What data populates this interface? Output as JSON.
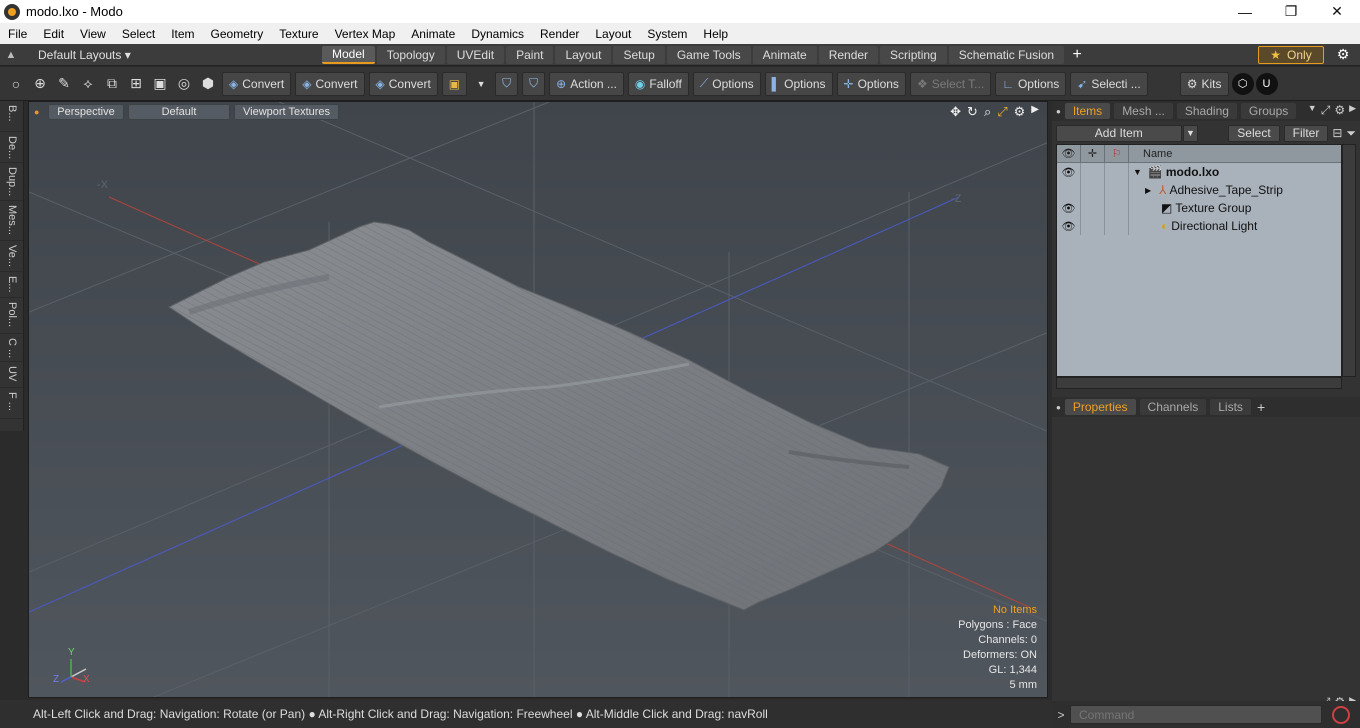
{
  "window": {
    "title": "modo.lxo - Modo",
    "minimize": "—",
    "maximize": "❐",
    "close": "✕"
  },
  "menu": [
    "File",
    "Edit",
    "View",
    "Select",
    "Item",
    "Geometry",
    "Texture",
    "Vertex Map",
    "Animate",
    "Dynamics",
    "Render",
    "Layout",
    "System",
    "Help"
  ],
  "layout": {
    "default_layouts": "Default Layouts ▾",
    "tabs": [
      "Model",
      "Topology",
      "UVEdit",
      "Paint",
      "Layout",
      "Setup",
      "Game Tools",
      "Animate",
      "Render",
      "Scripting",
      "Schematic Fusion"
    ],
    "active_tab": "Model",
    "only_label": "Only"
  },
  "toolbar": {
    "convert1": "Convert",
    "convert2": "Convert",
    "convert3": "Convert",
    "action": "Action ...",
    "falloff": "Falloff",
    "options1": "Options",
    "options2": "Options",
    "options3": "Options",
    "select_t": "Select T...",
    "options4": "Options",
    "selecti": "Selecti ...",
    "kits": "Kits"
  },
  "left_tabs": [
    "B...",
    "De...",
    "Dup...",
    "Mes...",
    "Ve...",
    "E...",
    "Pol...",
    "C ...",
    "UV",
    "F ..."
  ],
  "viewport": {
    "perspective": "Perspective",
    "default": "Default",
    "viewport_textures": "Viewport Textures",
    "axis_neg_x": "-X",
    "axis_neg_z": "-Z",
    "info": {
      "no_items": "No Items",
      "polygons": "Polygons : Face",
      "channels": "Channels: 0",
      "deformers": "Deformers: ON",
      "gl": "GL: 1,344",
      "scale": "5 mm"
    },
    "gizmo": {
      "y": "Y",
      "z": "Z",
      "x": "X"
    }
  },
  "status": "Alt-Left Click and Drag: Navigation: Rotate (or Pan) ● Alt-Right Click and Drag: Navigation: Freewheel ● Alt-Middle Click and Drag: navRoll",
  "items_panel": {
    "tabs": [
      "Items",
      "Mesh ...",
      "Shading",
      "Groups"
    ],
    "add_item": "Add Item",
    "select": "Select",
    "filter": "Filter",
    "col_name": "Name",
    "rows": [
      {
        "name": "modo.lxo",
        "bold": true
      },
      {
        "name": "Adhesive_Tape_Strip"
      },
      {
        "name": "Texture Group"
      },
      {
        "name": "Directional Light"
      }
    ]
  },
  "properties_panel": {
    "tabs": [
      "Properties",
      "Channels",
      "Lists"
    ]
  },
  "command": {
    "placeholder": "Command",
    "prompt": ">"
  }
}
